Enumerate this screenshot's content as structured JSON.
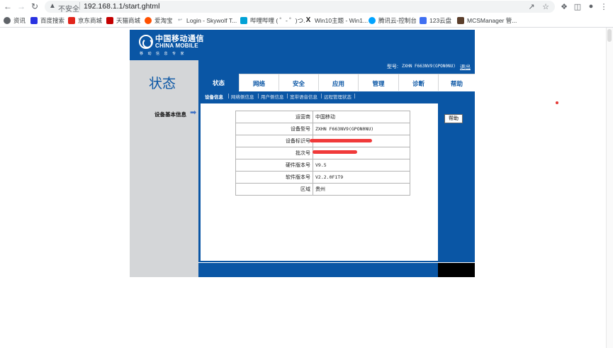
{
  "browser": {
    "security_label": "不安全",
    "url": "192.168.1.1/start.ghtml",
    "bookmarks": [
      {
        "label": "资讯",
        "icon": "globe-icon",
        "color": "#5f6368"
      },
      {
        "label": "百度搜索",
        "icon": "baidu-icon",
        "color": "#2932e1"
      },
      {
        "label": "京东商城",
        "icon": "jd-icon",
        "color": "#e1251b"
      },
      {
        "label": "天猫商城",
        "icon": "tmall-icon",
        "color": "#c40000"
      },
      {
        "label": "爱淘宝",
        "icon": "taobao-icon",
        "color": "#ff5000"
      },
      {
        "label": "Login - Skywolf T...",
        "icon": "page-icon",
        "color": "#9aa0a6"
      },
      {
        "label": "哔哩哔哩 ( ゜- ゜)つ...",
        "icon": "bilibili-icon",
        "color": "#00a1d6"
      },
      {
        "label": "Win10主题 - Win1...",
        "icon": "win10-icon",
        "color": "#222222"
      },
      {
        "label": "腾讯云-控制台",
        "icon": "tencent-cloud-icon",
        "color": "#00a3ff"
      },
      {
        "label": "123云盘",
        "icon": "cloud-drive-icon",
        "color": "#3f6ff2"
      },
      {
        "label": "MCSManager 管...",
        "icon": "mcsmanager-icon",
        "color": "#5a3e2b"
      }
    ]
  },
  "router": {
    "logo": {
      "cn": "中国移动通信",
      "en": "CHINA MOBILE",
      "sub": "移动信息专家"
    },
    "page_title": "状态",
    "model_label": "型号:",
    "model_value": "ZXHN F663NV9(GPON0NU)",
    "logout": "退出",
    "tabs": [
      "状态",
      "网络",
      "安全",
      "应用",
      "管理",
      "诊断",
      "帮助"
    ],
    "subtabs": [
      "设备信息",
      "网络侧信息",
      "用户侧信息",
      "宽带语音信息",
      "远程管理状态"
    ],
    "left_label": "设备基本信息",
    "help_button": "帮助",
    "info_rows": [
      {
        "key": "运营商",
        "value": "中国移动"
      },
      {
        "key": "设备型号",
        "value": "ZXHN F663NV9(GPON0NU)"
      },
      {
        "key": "设备标识号",
        "value": ""
      },
      {
        "key": "批次号",
        "value": ""
      },
      {
        "key": "硬件版本号",
        "value": "V9.5"
      },
      {
        "key": "软件版本号",
        "value": "V2.2.0F1T9"
      },
      {
        "key": "区域",
        "value": "贵州"
      }
    ]
  },
  "colors": {
    "brand_blue": "#0a56a5",
    "panel_gray": "#d4d6d8",
    "redaction": "#f03a3a"
  }
}
